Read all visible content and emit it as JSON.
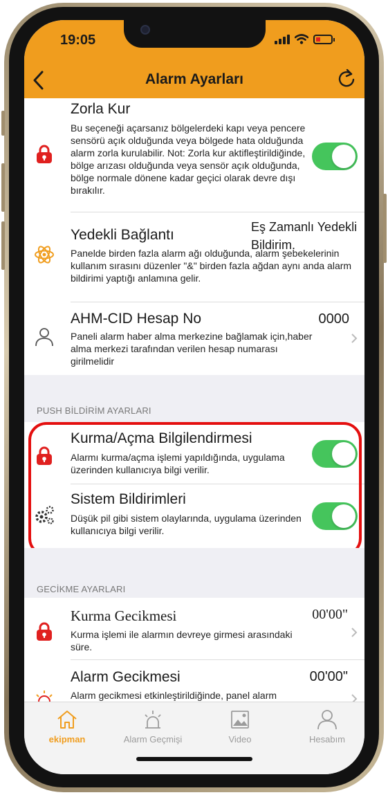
{
  "status": {
    "time": "19:05"
  },
  "nav": {
    "title": "Alarm Ayarları",
    "back_icon": "chevron-left-icon",
    "refresh_icon": "refresh-icon"
  },
  "colors": {
    "accent": "#f09d1e",
    "toggle_on": "#45c55c",
    "danger_icon": "#e0201f",
    "highlight": "#e40f0f"
  },
  "settings": {
    "zorla_kur": {
      "title": "Zorla Kur",
      "desc": "Bu seçeneği açarsanız bölgelerdeki kapı veya pencere sensörü açık olduğunda veya bölgede hata olduğunda alarm zorla kurulabilir. Not: Zorla kur aktifleştirildiğinde, bölge arızası olduğunda veya sensör açık olduğunda, bölge normale dönene kadar geçici olarak devre dışı bırakılır.",
      "enabled": true
    },
    "yedekli": {
      "title": "Yedekli Bağlantı",
      "value": "Eş Zamanlı Yedekli Bildirim.",
      "desc": "Panelde birden fazla alarm ağı olduğunda, alarm şebekelerinin kullanım sırasını düzenler \"&\" birden fazla ağdan aynı anda alarm bildirimi yaptığı anlamına gelir."
    },
    "ahm": {
      "title": "AHM-CID Hesap No",
      "value": "0000",
      "desc": "Paneli alarm haber alma merkezine bağlamak için,haber alma merkezi tarafından verilen hesap numarası girilmelidir"
    }
  },
  "push": {
    "header": "PUSH BİLDİRİM AYARLARI",
    "kurma": {
      "title": "Kurma/Açma Bilgilendirmesi",
      "desc": "Alarmı kurma/açma işlemi yapıldığında, uygulama üzerinden kullanıcıya bilgi verilir.",
      "enabled": true
    },
    "sistem": {
      "title": "Sistem Bildirimleri",
      "desc": "Düşük pil gibi sistem olaylarında, uygulama üzerinden kullanıcıya bilgi verilir.",
      "enabled": true
    }
  },
  "gecikme": {
    "header": "GECİKME AYARLARI",
    "kurma": {
      "title": "Kurma Gecikmesi",
      "value": "00'00\"",
      "desc": "Kurma işlemi ile alarmın devreye girmesi arasındaki süre."
    },
    "alarm": {
      "title": "Alarm Gecikmesi",
      "value": "00'00\"",
      "desc": "Alarm gecikmesi etkinleştirildiğinde, panel alarm"
    }
  },
  "tabs": [
    {
      "label": "ekipman",
      "icon": "home-icon",
      "active": true
    },
    {
      "label": "Alarm Geçmişi",
      "icon": "siren-icon",
      "active": false
    },
    {
      "label": "Video",
      "icon": "image-icon",
      "active": false
    },
    {
      "label": "Hesabım",
      "icon": "user-icon",
      "active": false
    }
  ]
}
